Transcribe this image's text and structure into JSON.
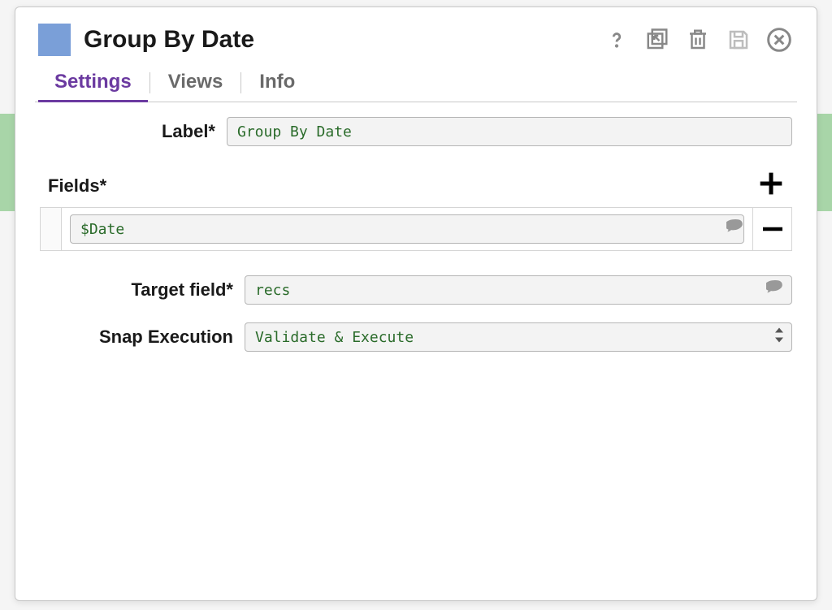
{
  "header": {
    "title": "Group By Date"
  },
  "tabs": {
    "settings": "Settings",
    "views": "Views",
    "info": "Info"
  },
  "form": {
    "label_label": "Label*",
    "label_value": "Group By Date",
    "fields_label": "Fields*",
    "field_rows": [
      {
        "value": "$Date"
      }
    ],
    "target_label": "Target field*",
    "target_value": "recs",
    "exec_label": "Snap Execution",
    "exec_value": "Validate & Execute"
  }
}
